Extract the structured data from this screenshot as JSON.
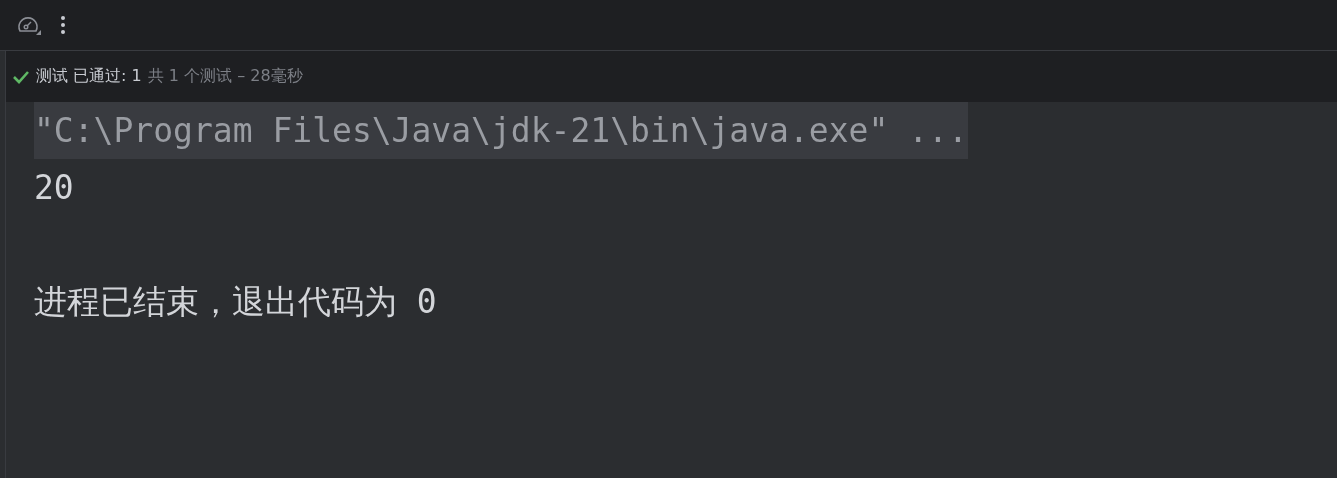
{
  "toolbar": {
    "buttons": [
      {
        "kind": "gauge"
      },
      {
        "kind": "more"
      }
    ]
  },
  "test_status": {
    "passed": true,
    "label": "测试 已通过: 1",
    "summary": "共 1 个测试 – 28毫秒"
  },
  "console": {
    "lines": [
      {
        "kind": "command",
        "text": "\"C:\\Program Files\\Java\\jdk-21\\bin\\java.exe\" ..."
      },
      {
        "kind": "output",
        "text": "20"
      },
      {
        "kind": "exit",
        "text": "进程已结束，退出代码为 0"
      }
    ]
  }
}
